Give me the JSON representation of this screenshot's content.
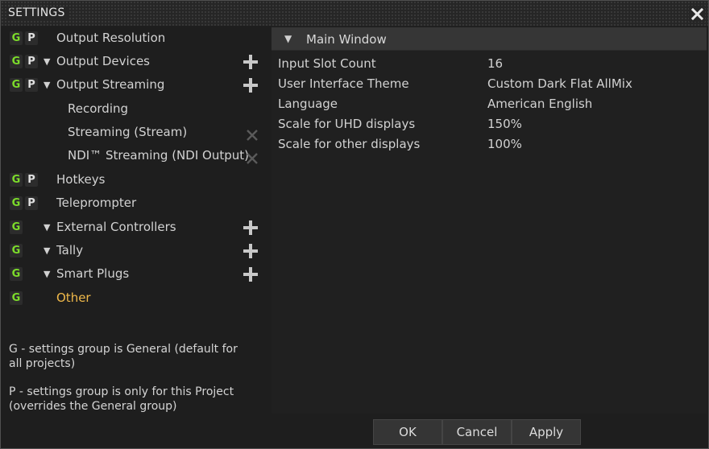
{
  "window": {
    "title": "SETTINGS"
  },
  "tree": {
    "items": [
      {
        "g": "G",
        "p": "P",
        "label": "Output Resolution"
      },
      {
        "g": "G",
        "p": "P",
        "label": "Output Devices"
      },
      {
        "g": "G",
        "p": "P",
        "label": "Output Streaming"
      },
      {
        "label": "Recording"
      },
      {
        "label": "Streaming (Stream)"
      },
      {
        "label": "NDI™ Streaming (NDI Output)"
      },
      {
        "g": "G",
        "p": "P",
        "label": "Hotkeys"
      },
      {
        "g": "G",
        "p": "P",
        "label": "Teleprompter"
      },
      {
        "g": "G",
        "label": "External Controllers"
      },
      {
        "g": "G",
        "label": "Tally"
      },
      {
        "g": "G",
        "label": "Smart Plugs"
      },
      {
        "g": "G",
        "label": "Other"
      }
    ]
  },
  "legend": {
    "general": "G - settings group is General (default for all projects)",
    "project": "P - settings group is only for this Project (overrides the General group)"
  },
  "panel": {
    "section_title": "Main Window",
    "properties": [
      {
        "key": "Input Slot Count",
        "value": "16"
      },
      {
        "key": "User Interface Theme",
        "value": "Custom Dark Flat AllMix"
      },
      {
        "key": "Language",
        "value": "American English"
      },
      {
        "key": "Scale for UHD displays",
        "value": "150%"
      },
      {
        "key": "Scale for other displays",
        "value": "100%"
      }
    ]
  },
  "buttons": {
    "ok": "OK",
    "cancel": "Cancel",
    "apply": "Apply"
  },
  "colors": {
    "general_badge": "#7cdc2a",
    "active_item": "#f0b94a"
  },
  "icons": {
    "close": "close-icon",
    "expand": "triangle-down-icon",
    "add": "plus-icon",
    "remove": "x-icon"
  }
}
